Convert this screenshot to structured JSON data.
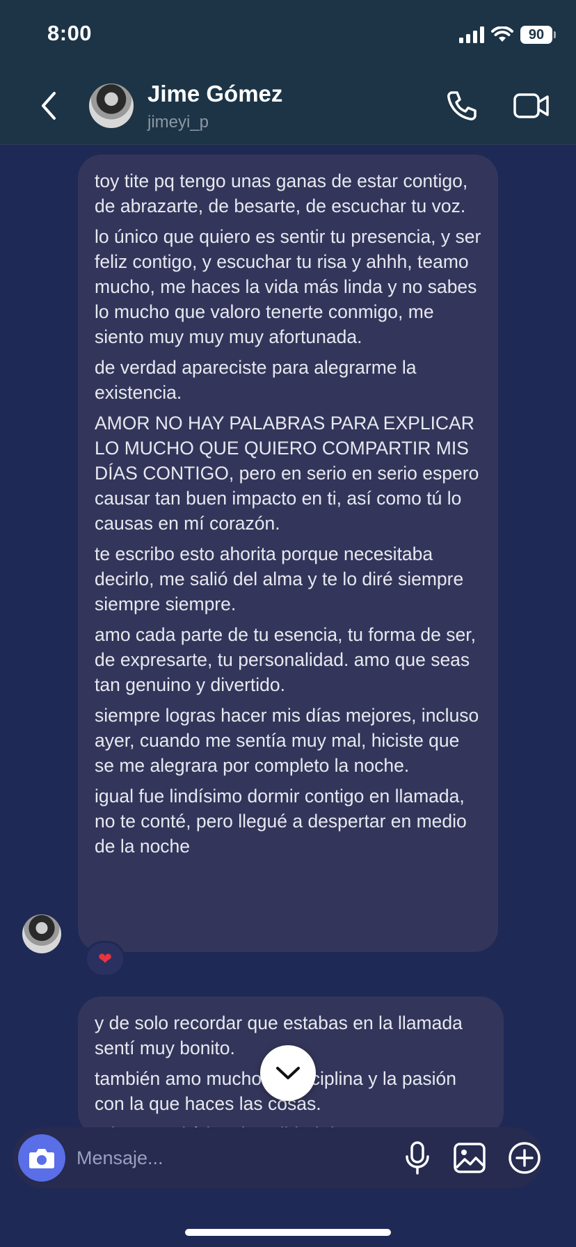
{
  "status_bar": {
    "time": "8:00",
    "battery": "90",
    "icons": [
      "signal-icon",
      "wifi-icon",
      "battery-icon"
    ]
  },
  "header": {
    "contact_name": "Jime Gómez",
    "username": "jimeyi_p",
    "icons": [
      "back-icon",
      "phone-icon",
      "video-camera-icon"
    ]
  },
  "messages": [
    {
      "paragraphs": [
        "toy tite pq tengo unas ganas de estar contigo, de abrazarte, de besarte, de escuchar tu voz.",
        "lo único que quiero es sentir tu presencia, y ser feliz contigo, y escuchar tu risa y ahhh, teamo mucho, me haces la vida más linda y no sabes lo mucho que valoro tenerte conmigo, me siento muy muy muy afortunada.",
        "de verdad apareciste para alegrarme la existencia.",
        "AMOR NO HAY PALABRAS PARA EXPLICAR LO MUCHO QUE QUIERO COMPARTIR MIS DÍAS CONTIGO, pero en serio en serio espero causar tan buen impacto en ti, así como tú lo causas en mí corazón.",
        "te escribo esto ahorita porque necesitaba decirlo, me salió del alma y te lo diré siempre siempre siempre.",
        "amo cada parte de tu esencia, tu forma de ser, de expresarte, tu personalidad. amo que seas tan genuino y divertido.",
        "siempre logras hacer mis días mejores, incluso ayer, cuando me sentía muy mal, hiciste que se me alegrara por completo la noche.",
        "igual fue lindísimo dormir contigo en llamada, no te conté, pero llegué a despertar en medio de la noche"
      ],
      "reaction": "❤"
    },
    {
      "paragraphs": [
        "y de solo recordar que estabas en la llamada sentí muy bonito.",
        "también amo mucho tu disciplina y la pasión con la que haces las cosas.",
        "adoro muchísimo la calidad de persona"
      ]
    }
  ],
  "composer": {
    "placeholder": "Mensaje...",
    "icons": [
      "camera-icon",
      "microphone-icon",
      "image-icon",
      "add-icon"
    ]
  },
  "colors": {
    "background": "#1f2956",
    "header": "#1c3446",
    "bubble": "#33365a",
    "camera_button": "#5a6ee8",
    "reaction_heart": "#e8343f"
  }
}
